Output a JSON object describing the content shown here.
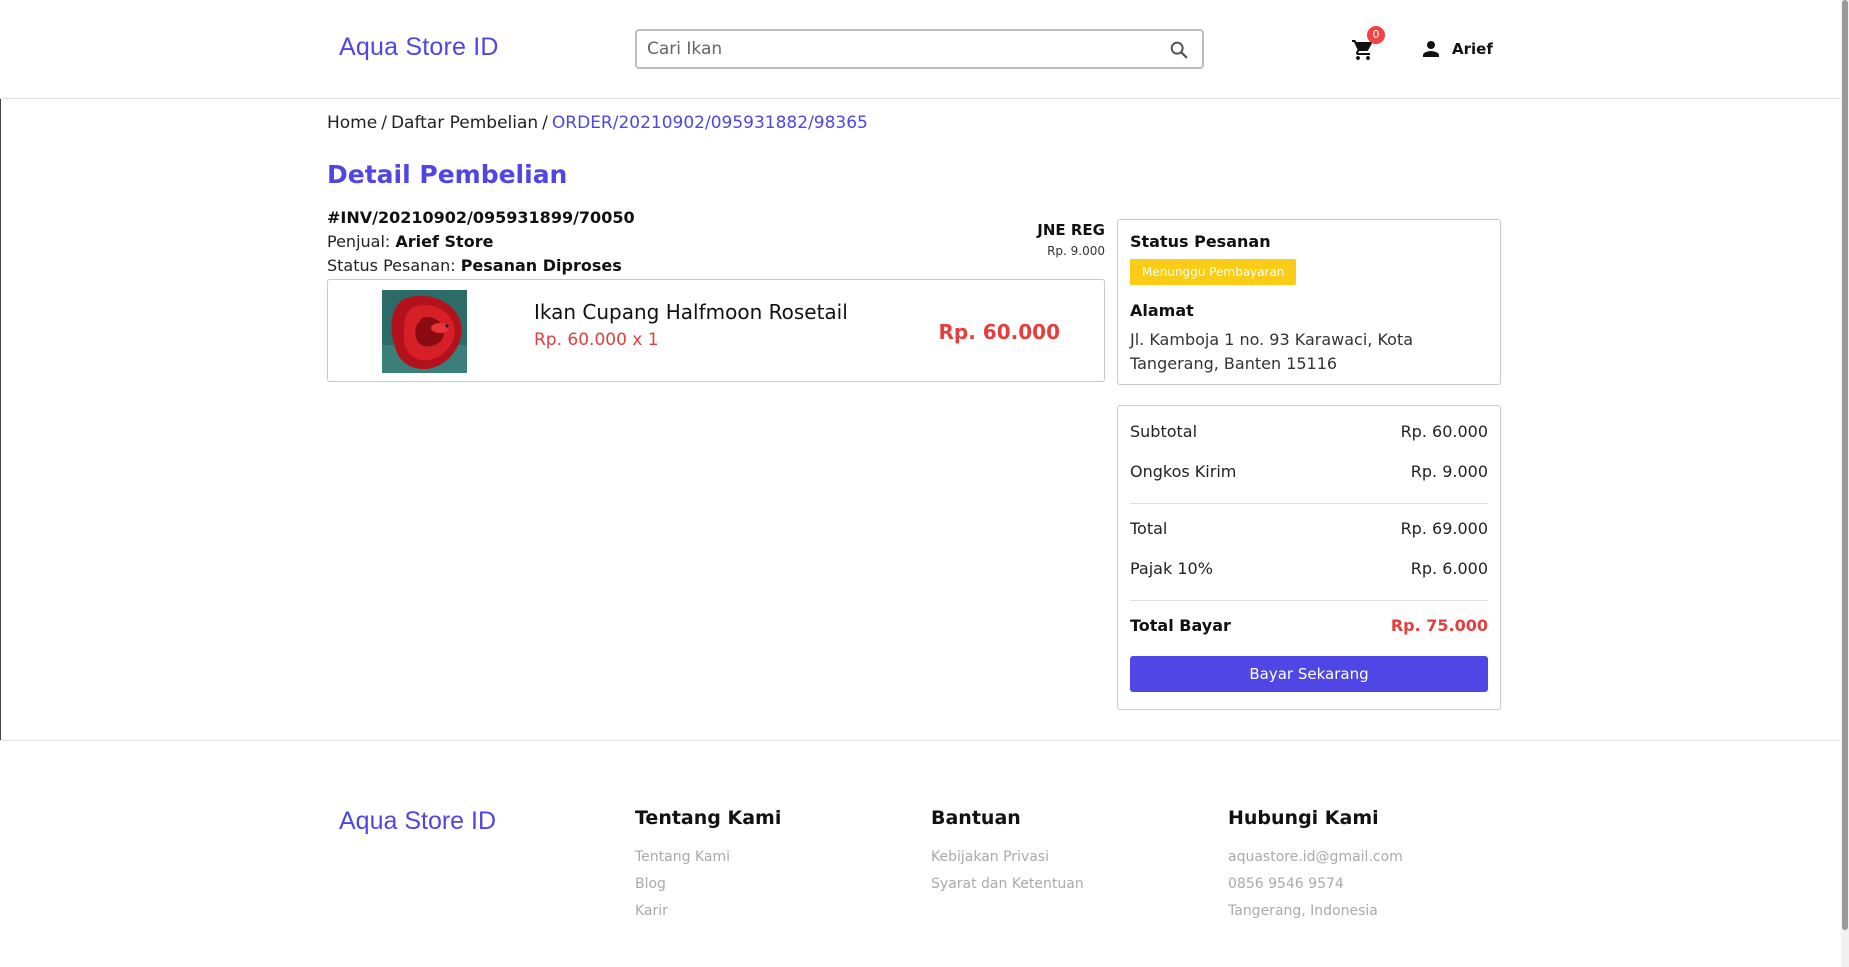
{
  "header": {
    "brand": "Aqua Store ID",
    "search_placeholder": "Cari Ikan",
    "cart_count": "0",
    "user_name": "Arief"
  },
  "breadcrumb": {
    "items": [
      "Home",
      "Daftar Pembelian"
    ],
    "separator": "/",
    "current": "ORDER/20210902/095931882/98365"
  },
  "page": {
    "title": "Detail Pembelian",
    "invoice": "#INV/20210902/095931899/70050",
    "seller_label": "Penjual:",
    "seller_name": "Arief Store",
    "status_label": "Status Pesanan:",
    "status_value": "Pesanan Diproses"
  },
  "shipping": {
    "courier": "JNE REG",
    "cost": "Rp. 9.000"
  },
  "product": {
    "name": "Ikan Cupang Halfmoon Rosetail",
    "price_qty": "Rp. 60.000 x 1",
    "total": "Rp. 60.000",
    "image_icon": "betta-fish-image"
  },
  "status_card": {
    "heading": "Status Pesanan",
    "badge": "Menunggu Pembayaran",
    "address_heading": "Alamat",
    "address": "Jl. Kamboja 1 no. 93 Karawaci, Kota Tangerang, Banten 15116"
  },
  "summary": {
    "subtotal_label": "Subtotal",
    "subtotal_value": "Rp. 60.000",
    "shipping_label": "Ongkos Kirim",
    "shipping_value": "Rp. 9.000",
    "total_label": "Total",
    "total_value": "Rp. 69.000",
    "tax_label": "Pajak 10%",
    "tax_value": "Rp. 6.000",
    "grand_label": "Total Bayar",
    "grand_value": "Rp. 75.000",
    "pay_button": "Bayar Sekarang"
  },
  "footer": {
    "brand": "Aqua Store ID",
    "columns": [
      {
        "title": "Tentang Kami",
        "links": [
          "Tentang Kami",
          "Blog",
          "Karir"
        ]
      },
      {
        "title": "Bantuan",
        "links": [
          "Kebijakan Privasi",
          "Syarat dan Ketentuan"
        ]
      },
      {
        "title": "Hubungi Kami",
        "links": [
          "aquastore.id@gmail.com",
          "0856 9546 9574",
          "Tangerang, Indonesia"
        ]
      }
    ]
  },
  "colors": {
    "brand": "#4f46e5",
    "price": "#e53e3e",
    "badge": "#facc15",
    "cart_badge": "#ef4444"
  }
}
